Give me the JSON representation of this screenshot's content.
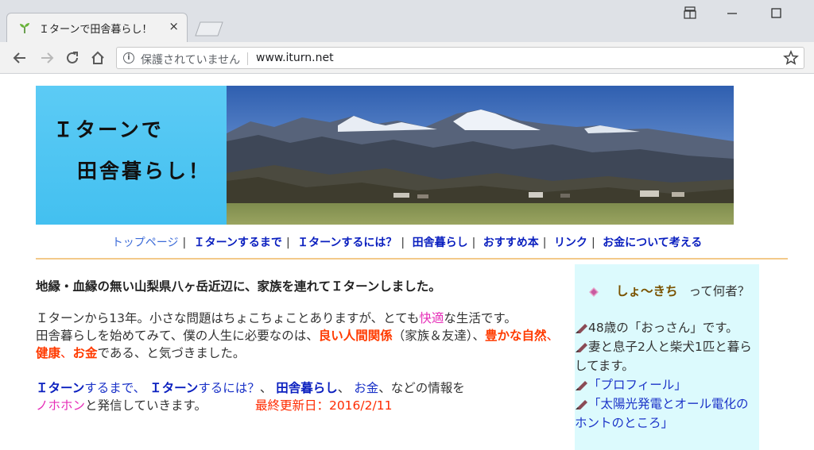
{
  "browser": {
    "tab_title": "Ｉターンで田舎暮らし！",
    "tab_close": "×",
    "security_text": "保護されていません",
    "url": "www.iturn.net"
  },
  "banner": {
    "title_line1": "Ｉターンで",
    "title_line2": "田舎暮らし！"
  },
  "nav": {
    "items": [
      {
        "label": "トップページ"
      },
      {
        "label": "Ｉターンするまで"
      },
      {
        "label": "Ｉターンするには？"
      },
      {
        "label": "田舎暮らし"
      },
      {
        "label": "おすすめ本"
      },
      {
        "label": "リンク"
      },
      {
        "label": "お金について考える"
      }
    ],
    "separator": "|"
  },
  "main": {
    "headline": "地縁・血縁の無い山梨県八ヶ岳近辺に、家族を連れてＩターンしました。",
    "p1_a": "Ｉターンから13年。小さな問題はちょこちょことありますが、とても",
    "p1_pink": "快適",
    "p1_b": "な生活です。",
    "p2_a": "田舎暮らしを始めてみて、僕の人生に必要なのは、",
    "p2_good": "良い人間関係",
    "p2_b": "（家族＆友達）、",
    "p2_nature": "豊かな自然",
    "p2_c": "、",
    "p2_health": "健康",
    "p2_d": "、",
    "p2_money": "お金",
    "p2_e": "である、と気づきました。",
    "p3_iturn1": "Ｉターン",
    "p3_a": "するまで、",
    "p3_iturn2": "Ｉターン",
    "p3_b": "するには？",
    "p3_c": "、",
    "p3_inaka": "田舎暮らし",
    "p3_d": "、",
    "p3_money": "お金",
    "p3_e": "、などの情報を",
    "p3_nohon": "ノホホン",
    "p3_f": "と発信していきます。",
    "updated": "最終更新日：2016/2/11"
  },
  "sidebar": {
    "name": "しょ～きち",
    "name_suffix": "って何者？",
    "items": [
      {
        "text": "48歳の「おっさん」です。",
        "link": false
      },
      {
        "text": "妻と息子2人と柴犬1匹と暮らしてます。",
        "link": false
      },
      {
        "text": "「プロフィール」",
        "link": true
      },
      {
        "text": "「太陽光発電とオール電化のホントのところ」",
        "link": true
      }
    ]
  },
  "colors": {
    "banner_sky": "#43c0f0",
    "nav_link": "#0a1fbf",
    "accent_red": "#ff3b00",
    "accent_pink": "#e62fb8",
    "sidebar_bg": "#dcfafd",
    "divider": "#f3c98a"
  },
  "icons": [
    "sprout-favicon-icon",
    "close-icon",
    "minimize-icon",
    "maximize-icon",
    "back-arrow-icon",
    "forward-arrow-icon",
    "reload-icon",
    "home-icon",
    "info-icon",
    "star-icon",
    "gem-icon",
    "pen-icon"
  ]
}
